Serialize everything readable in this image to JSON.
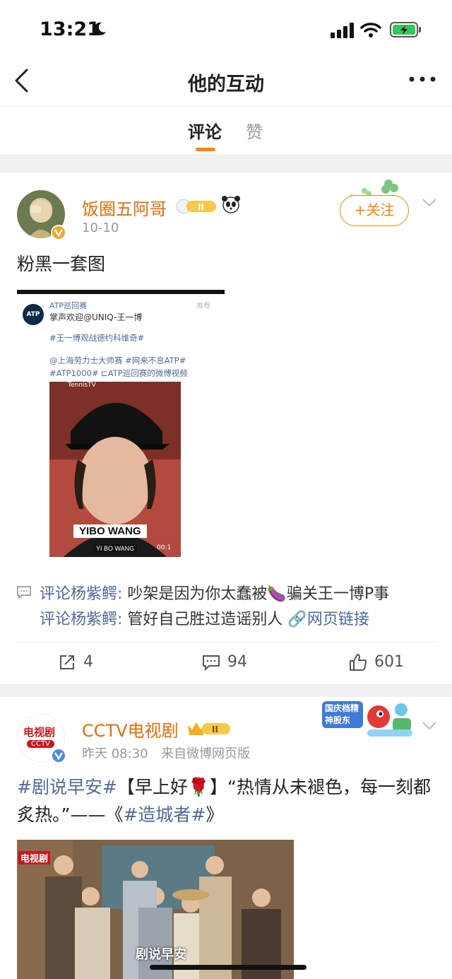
{
  "status": {
    "time": "13:21"
  },
  "nav": {
    "title": "他的互动"
  },
  "tabs": [
    {
      "label": "评论"
    },
    {
      "label": "赞"
    }
  ],
  "post1": {
    "username": "饭圈五阿哥",
    "honor_level": "II",
    "time": "10-10",
    "follow_label": "+关注",
    "text": "粉黑一套图",
    "embed": {
      "account": "ATP巡回赛",
      "rec": "推荐",
      "line1": "掌声欢迎@UNIQ-王一博",
      "tag1": "#王一博观战德约科维奇#",
      "tag2": "@上海劳力士大师赛 #网来不息ATP#",
      "tag3": "#ATP1000# ⊏ATP巡回赛的微博视频",
      "video_wm": "TennisTV",
      "caption": "YIBO WANG",
      "subcaption": "YI BO WANG",
      "video_time": "00:1",
      "logo_text": "ATP"
    },
    "comments": [
      {
        "label": "评论杨紫鳄:",
        "text": " 吵架是因为你太蠢被",
        "emoji": "🍆",
        "rest": "骗关王一博P事"
      },
      {
        "label": "评论杨紫鳄:",
        "text": " 管好自己胜过造谣别人",
        "link": "网页链接"
      }
    ],
    "actions": {
      "repost": "4",
      "comment": "94",
      "like": "601"
    }
  },
  "post2": {
    "username": "CCTV电视剧",
    "honor_level": "II",
    "avatar_text": "电视剧",
    "avatar_sub": "CCTV",
    "time": "昨天 08:30",
    "source": "来自微博网页版",
    "text_topic1": "#剧说早安#",
    "text_mid": "【早上好🌹】“热情从未褪色，每一刻都炙热。”——《",
    "text_topic2": "#造城者#",
    "text_end": "》",
    "photo_caption": "剧说早安",
    "photo_logo": "电视剧",
    "badge_text": "国庆档精神股东"
  },
  "colors": {
    "accent": "#ff8200",
    "link": "#506a9a",
    "name": "#e86b0c"
  }
}
